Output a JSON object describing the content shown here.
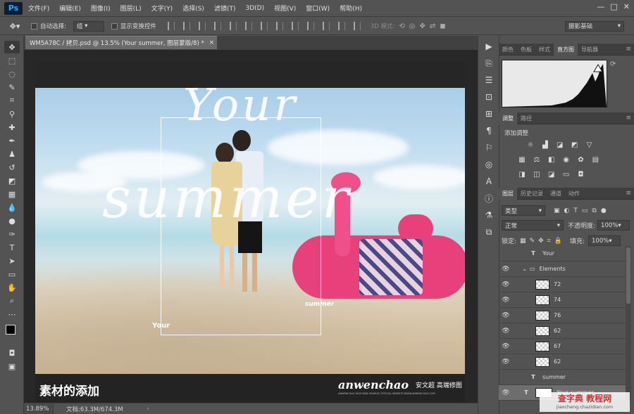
{
  "app": {
    "logo": "Ps"
  },
  "menu": [
    "文件(F)",
    "编辑(E)",
    "图像(I)",
    "图层(L)",
    "文字(Y)",
    "选择(S)",
    "滤镜(T)",
    "3D(D)",
    "视图(V)",
    "窗口(W)",
    "帮助(H)"
  ],
  "window_controls": [
    "—",
    "□",
    "✕"
  ],
  "options": {
    "auto_select_label": "自动选择:",
    "auto_select_value": "组",
    "show_transform_label": "显示变换控件",
    "mode_3d": "3D 模式:",
    "workspace": "摄影基础"
  },
  "document": {
    "tab_title": "WM5A78C / 拷贝.psd @ 13.5% (Your summer, 图层蒙版/8) *",
    "zoom": "13.89%",
    "doc_info": "文档:63.3M/674.3M",
    "caption": "素材的添加",
    "brand": "anwenchao",
    "brand_cn": "安文超 高端修图",
    "brand_small": "ANWENCHAO HIGH-END GRAPHIC OFFICIAL WEBSITE:WWW.ANWENCHAO.COM",
    "script_your": "Your",
    "script_summer": "summer",
    "small_your": "Your",
    "small_summer": "summer"
  },
  "panels": {
    "top_tabs": [
      "颜色",
      "色板",
      "样式",
      "直方图",
      "导航器"
    ],
    "top_active": 3,
    "adj_tabs": [
      "调整",
      "路径"
    ],
    "adj_title": "添加调整",
    "layers_tabs": [
      "图层",
      "历史记录",
      "通道",
      "动作"
    ],
    "filter_kind": "类型",
    "blend_mode": "正常",
    "opacity_label": "不透明度:",
    "opacity_value": "100%",
    "lock_label": "锁定:",
    "fill_label": "填充:",
    "fill_value": "100%"
  },
  "layers": [
    {
      "name": "Your",
      "kind": "text"
    },
    {
      "name": "Elements",
      "kind": "group"
    },
    {
      "name": "72",
      "kind": "pixel"
    },
    {
      "name": "74",
      "kind": "pixel"
    },
    {
      "name": "76",
      "kind": "pixel"
    },
    {
      "name": "62",
      "kind": "pixel"
    },
    {
      "name": "67",
      "kind": "pixel"
    },
    {
      "name": "62",
      "kind": "pixel"
    },
    {
      "name": "summer",
      "kind": "text"
    },
    {
      "name": "Your summer",
      "kind": "smart",
      "selected": true
    }
  ],
  "watermark": {
    "line1": "查字典 教程网",
    "line2": "jiaocheng.chazidian.com"
  },
  "colors": {
    "flamingo": "#e8407a",
    "panel_bg": "#535353",
    "canvas_bg": "#282828"
  }
}
